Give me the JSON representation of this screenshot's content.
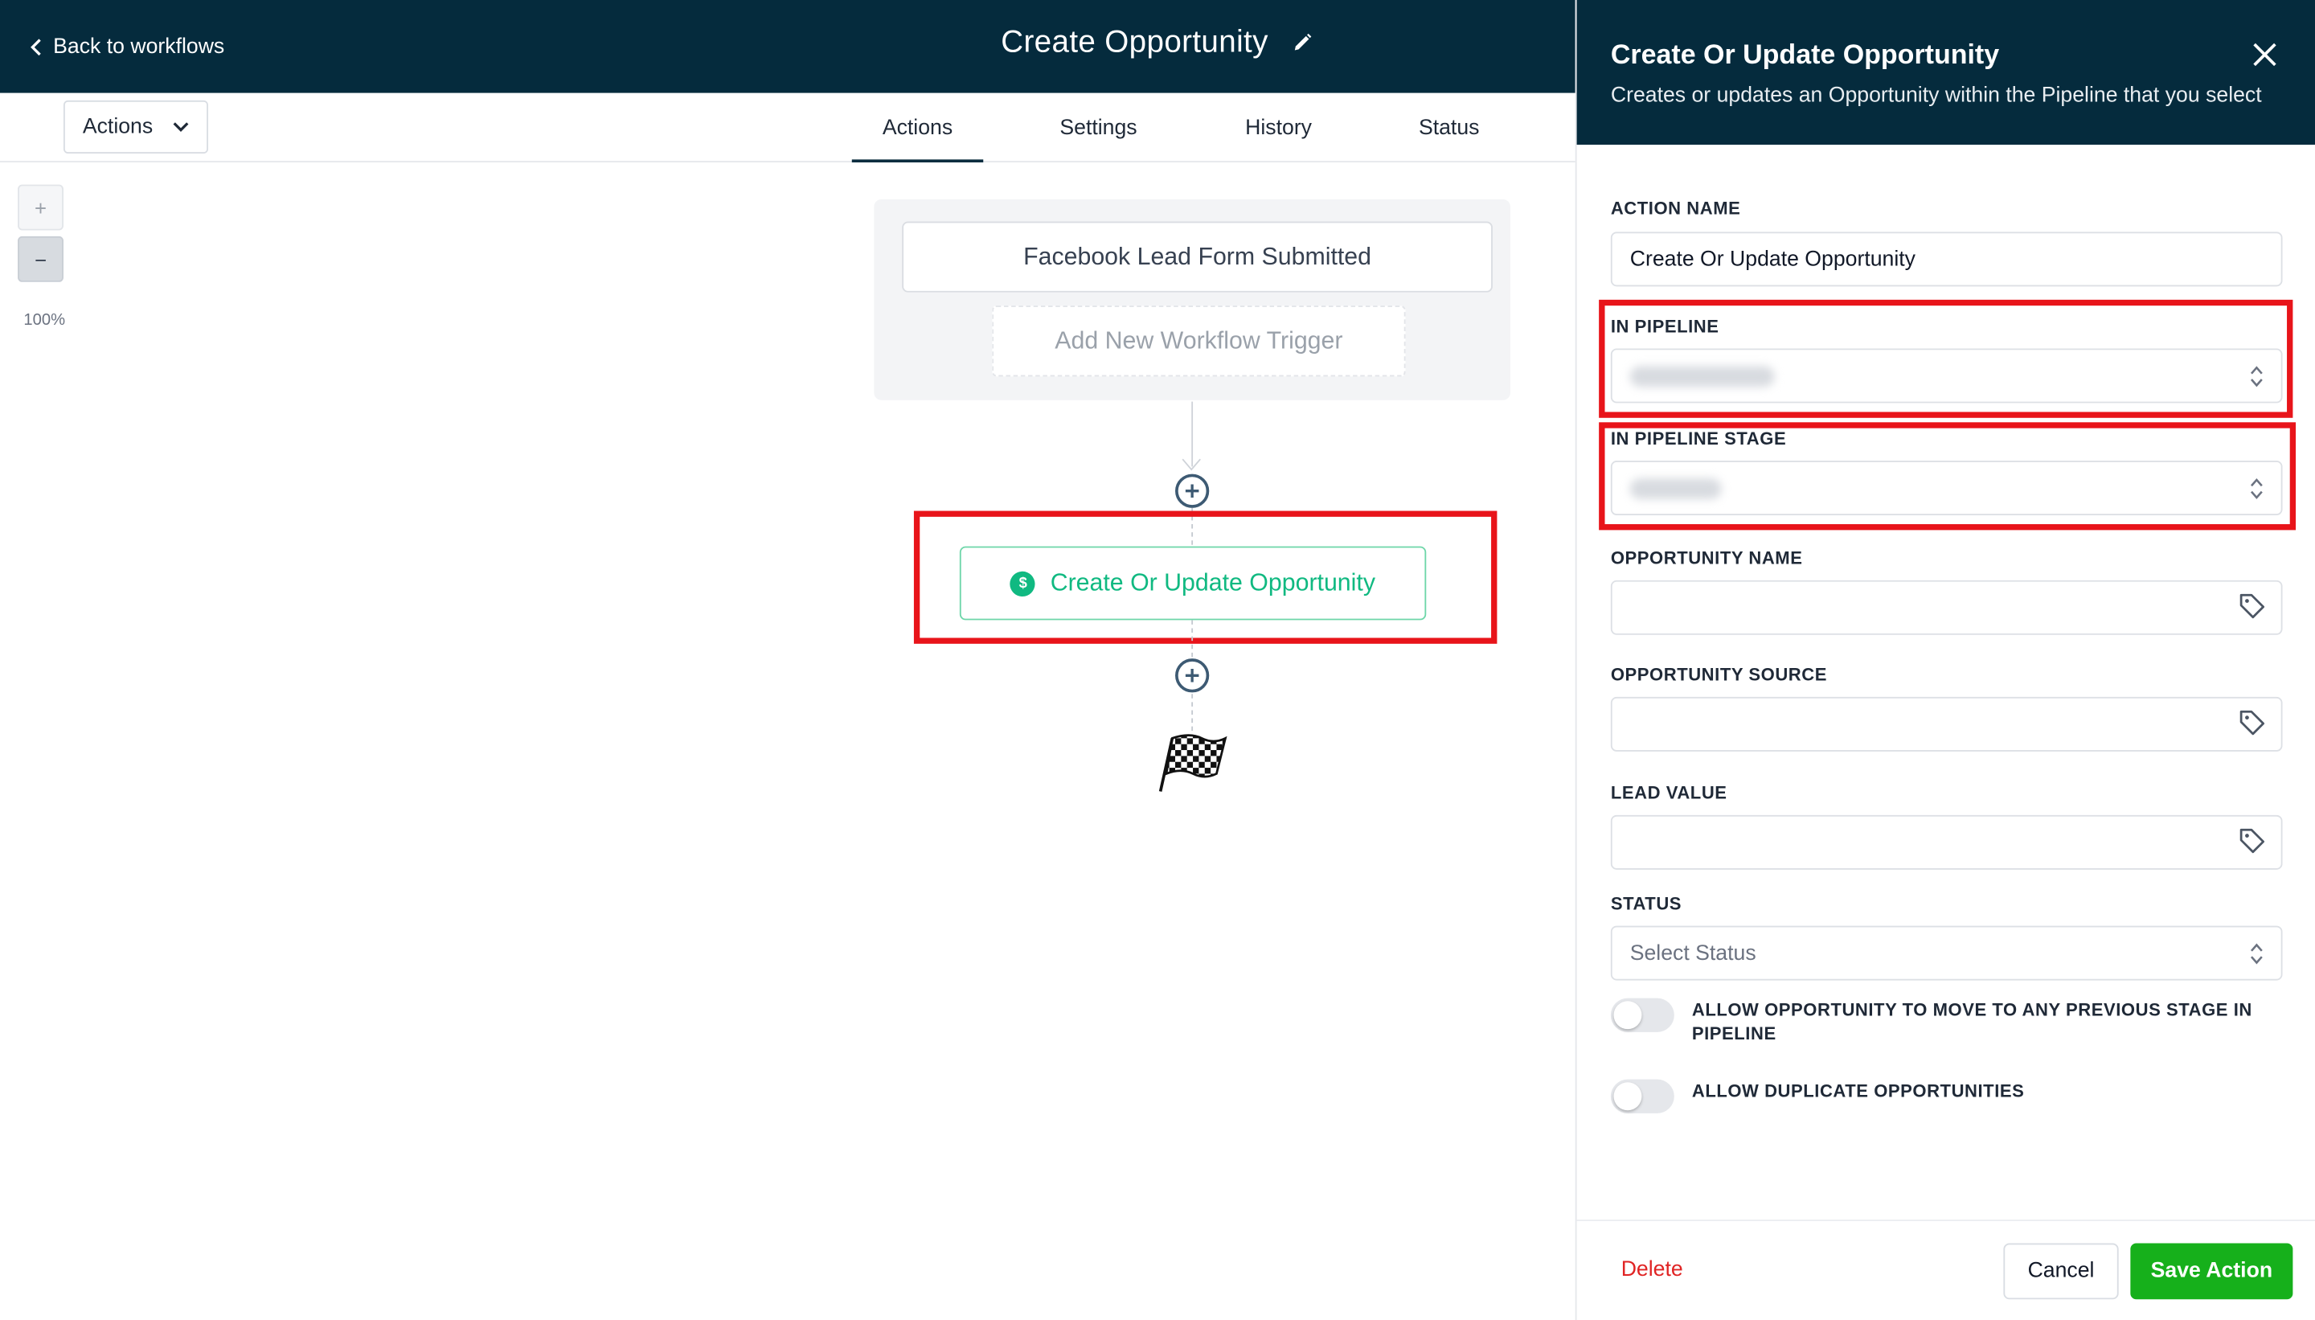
{
  "colors": {
    "header_bg": "#052b3d",
    "accent_green": "#10b981",
    "save_green": "#16b01b",
    "highlight_red": "#e8141a",
    "delete_red": "#e02424"
  },
  "header": {
    "back_label": "Back to workflows",
    "workflow_title": "Create Opportunity"
  },
  "toolbar": {
    "actions_dropdown": "Actions",
    "tabs": [
      {
        "label": "Actions",
        "active": true
      },
      {
        "label": "Settings",
        "active": false
      },
      {
        "label": "History",
        "active": false
      },
      {
        "label": "Status",
        "active": false
      }
    ]
  },
  "canvas": {
    "zoom_in": "+",
    "zoom_out": "−",
    "zoom_level": "100%",
    "trigger_label": "Facebook Lead Form Submitted",
    "add_trigger_label": "Add New Workflow Trigger",
    "action_label": "Create Or Update Opportunity",
    "action_icon": "$"
  },
  "panel": {
    "title": "Create Or Update Opportunity",
    "subtitle": "Creates or updates an Opportunity within the Pipeline that you select",
    "fields": {
      "action_name": {
        "label": "ACTION NAME",
        "value": "Create Or Update Opportunity"
      },
      "in_pipeline": {
        "label": "IN PIPELINE"
      },
      "in_pipeline_stage": {
        "label": "IN PIPELINE STAGE"
      },
      "opportunity_name": {
        "label": "OPPORTUNITY NAME",
        "value": ""
      },
      "opportunity_source": {
        "label": "OPPORTUNITY SOURCE",
        "value": ""
      },
      "lead_value": {
        "label": "LEAD VALUE",
        "value": ""
      },
      "status": {
        "label": "STATUS",
        "placeholder": "Select Status"
      }
    },
    "toggles": {
      "allow_previous_stage": {
        "label": "ALLOW OPPORTUNITY TO MOVE TO ANY PREVIOUS STAGE IN PIPELINE",
        "on": false
      },
      "allow_duplicates": {
        "label": "ALLOW DUPLICATE OPPORTUNITIES",
        "on": false
      }
    },
    "footer": {
      "delete_label": "Delete",
      "cancel_label": "Cancel",
      "save_label": "Save Action"
    }
  }
}
